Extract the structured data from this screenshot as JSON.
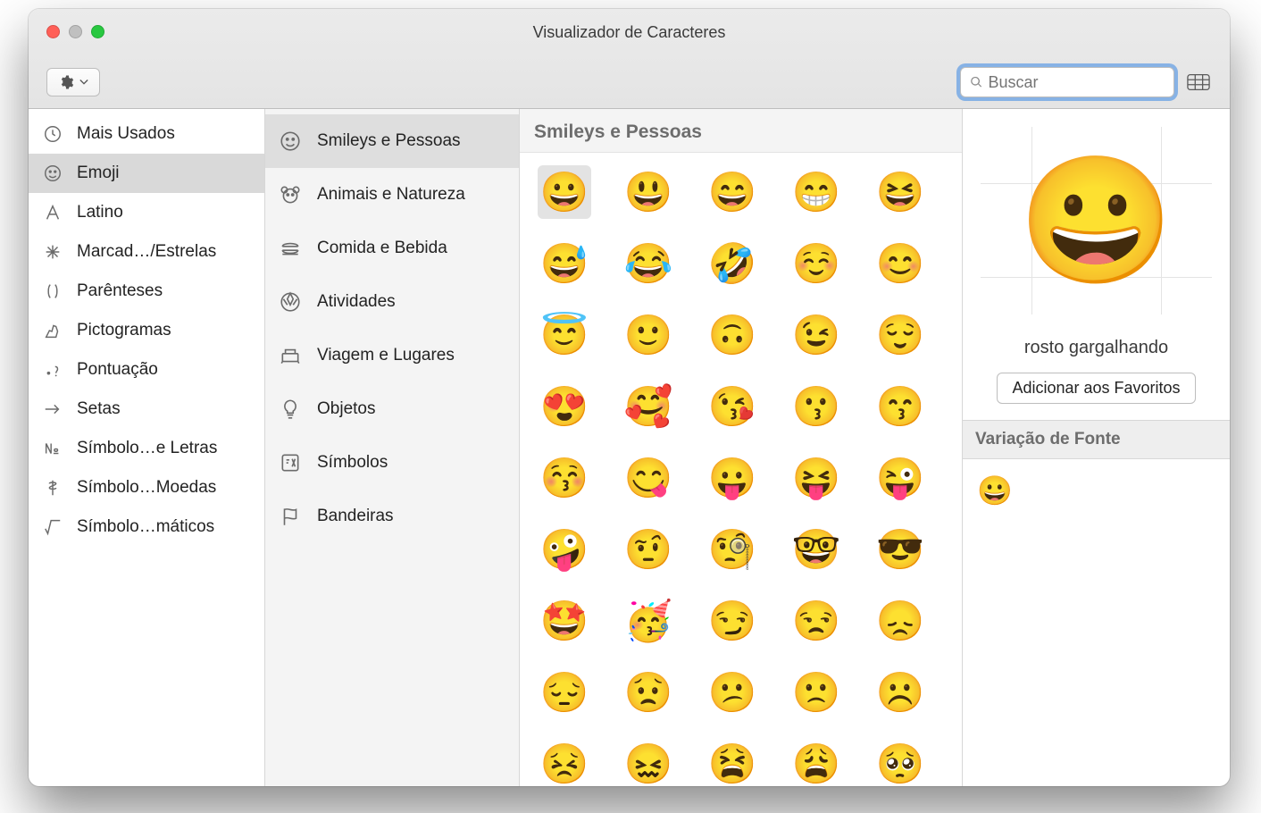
{
  "window": {
    "title": "Visualizador de Caracteres"
  },
  "search": {
    "placeholder": "Buscar",
    "value": ""
  },
  "sidebar1": {
    "items": [
      {
        "label": "Mais Usados",
        "icon": "clock"
      },
      {
        "label": "Emoji",
        "icon": "smiley",
        "selected": true
      },
      {
        "label": "Latino",
        "icon": "letterA"
      },
      {
        "label": "Marcad…/Estrelas",
        "icon": "asterisk"
      },
      {
        "label": "Parênteses",
        "icon": "parens"
      },
      {
        "label": "Pictogramas",
        "icon": "hand"
      },
      {
        "label": "Pontuação",
        "icon": "punct"
      },
      {
        "label": "Setas",
        "icon": "arrow"
      },
      {
        "label": "Símbolo…e Letras",
        "icon": "numero"
      },
      {
        "label": "Símbolo…Moedas",
        "icon": "dollar"
      },
      {
        "label": "Símbolo…máticos",
        "icon": "root"
      }
    ]
  },
  "sidebar2": {
    "items": [
      {
        "label": "Smileys e Pessoas",
        "icon": "smiley",
        "selected": true
      },
      {
        "label": "Animais e Natureza",
        "icon": "bear"
      },
      {
        "label": "Comida e Bebida",
        "icon": "burger"
      },
      {
        "label": "Atividades",
        "icon": "ball"
      },
      {
        "label": "Viagem e Lugares",
        "icon": "travel"
      },
      {
        "label": "Objetos",
        "icon": "bulb"
      },
      {
        "label": "Símbolos",
        "icon": "symbols"
      },
      {
        "label": "Bandeiras",
        "icon": "flag"
      }
    ]
  },
  "grid": {
    "header": "Smileys e Pessoas",
    "rows": [
      [
        "😀",
        "😃",
        "😄",
        "😁",
        "😆"
      ],
      [
        "😅",
        "😂",
        "🤣",
        "☺️",
        "😊"
      ],
      [
        "😇",
        "🙂",
        "🙃",
        "😉",
        "😌"
      ],
      [
        "😍",
        "🥰",
        "😘",
        "😗",
        "😙"
      ],
      [
        "😚",
        "😋",
        "😛",
        "😝",
        "😜"
      ],
      [
        "🤪",
        "🤨",
        "🧐",
        "🤓",
        "😎"
      ],
      [
        "🤩",
        "🥳",
        "😏",
        "😒",
        "😞"
      ],
      [
        "😔",
        "😟",
        "😕",
        "🙁",
        "☹️"
      ],
      [
        "😣",
        "😖",
        "😫",
        "😩",
        "🥺"
      ]
    ],
    "selected_row": 0,
    "selected_col": 0
  },
  "detail": {
    "preview": "😀",
    "name": "rosto gargalhando",
    "favorites_button": "Adicionar aos Favoritos",
    "font_variation_header": "Variação de Fonte",
    "font_variation_char": "😀"
  }
}
